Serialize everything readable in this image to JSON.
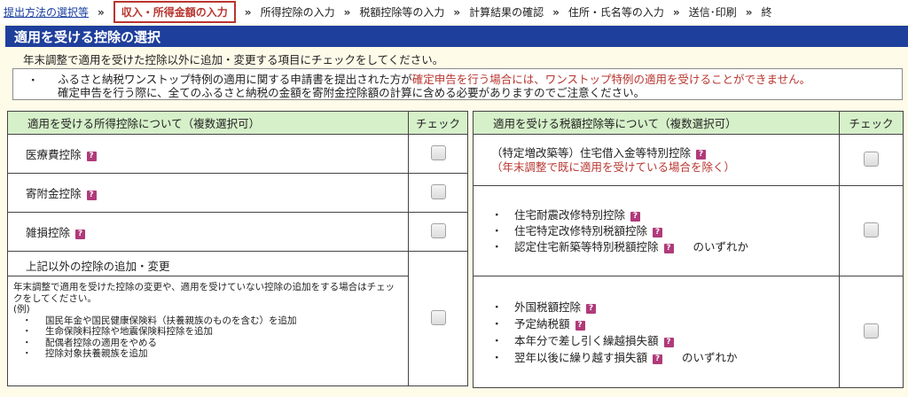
{
  "breadcrumb": {
    "step1": "提出方法の選択等",
    "step2": "収入・所得金額の入力",
    "step3": "所得控除の入力",
    "step4": "税額控除等の入力",
    "step5": "計算結果の確認",
    "step6": "住所・氏名等の入力",
    "step7": "送信･印刷",
    "step8": "終",
    "separator": "»"
  },
  "page_title": "適用を受ける控除の選択",
  "instruction": "年末調整で適用を受けた控除以外に追加・変更する項目にチェックをしてください。",
  "notice": {
    "bullet": "・",
    "line1_prefix": "ふるさと納税ワンストップ特例の適用に関する申請書を提出された方が",
    "line1_red": "確定申告を行う場合には、ワンストップ特例の適用を受けることができません。",
    "line2": "確定申告を行う際に、全てのふるさと納税の金額を寄附金控除額の計算に含める必要がありますのでご注意ください。"
  },
  "left_table": {
    "header_name": "適用を受ける所得控除について（複数選択可）",
    "header_check": "チェック",
    "row1": "医療費控除",
    "row2": "寄附金控除",
    "row3": "雑損控除",
    "row4_title": "上記以外の控除の追加・変更",
    "row4_desc": "年末調整で適用を受けた控除の変更や、適用を受けていない控除の追加をする場合はチェックをしてください。",
    "row4_example": "(例)",
    "row4_ex1": "国民年金や国民健康保険料（扶養親族のものを含む）を追加",
    "row4_ex2": "生命保険料控除や地震保険料控除を追加",
    "row4_ex3": "配偶者控除の適用をやめる",
    "row4_ex4": "控除対象扶養親族を追加"
  },
  "right_table": {
    "header_name": "適用を受ける税額控除等について（複数選択可）",
    "header_check": "チェック",
    "r1_line1": "（特定増改築等）住宅借入金等特別控除",
    "r1_line2": "（年末調整で既に適用を受けている場合を除く）",
    "r2_item1": "住宅耐震改修特別控除",
    "r2_item2": "住宅特定改修特別税額控除",
    "r2_item3": "認定住宅新築等特別税額控除",
    "r2_suffix": "のいずれか",
    "r3_item1": "外国税額控除",
    "r3_item2": "予定納税額",
    "r3_item3": "本年分で差し引く繰越損失額",
    "r3_item4": "翌年以後に繰り越す損失額",
    "r3_suffix": "のいずれか"
  },
  "help_icon": "?",
  "bullet": "・",
  "colors": {
    "title_bar": "#1f3f9c",
    "header_green": "#d6f0c9",
    "warning_red": "#b8352f",
    "help_magenta": "#b03a7a",
    "background": "#fffbe9"
  }
}
